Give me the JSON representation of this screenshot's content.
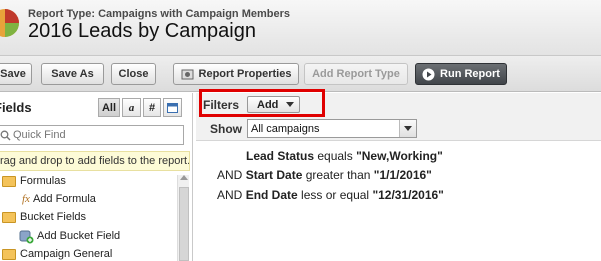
{
  "header": {
    "report_type": "Report Type: Campaigns with Campaign Members",
    "title": "2016 Leads by Campaign"
  },
  "toolbar": {
    "save": "Save",
    "save_as": "Save As",
    "close": "Close",
    "report_properties": "Report Properties",
    "add_report_type": "Add Report Type",
    "run_report": "Run Report"
  },
  "fields_panel": {
    "title": "Fields",
    "segments": [
      "All",
      "a",
      "#",
      "cal"
    ],
    "quick_find_placeholder": "Quick Find",
    "hint": "Drag and drop to add fields to the report.",
    "tree": [
      {
        "label": "Formulas",
        "type": "folder"
      },
      {
        "label": "Add Formula",
        "type": "item"
      },
      {
        "label": "Bucket Fields",
        "type": "folder"
      },
      {
        "label": "Add Bucket Field",
        "type": "item"
      },
      {
        "label": "Campaign General",
        "type": "folder"
      }
    ]
  },
  "filters": {
    "label": "Filters",
    "add_button": "Add",
    "show_label": "Show",
    "show_value": "All campaigns",
    "lines": [
      {
        "prefix": "",
        "field": "Lead Status",
        "operator": "equals",
        "value": "\"New,Working\""
      },
      {
        "prefix": "AND",
        "field": "Start Date",
        "operator": "greater than",
        "value": "\"1/1/2016\""
      },
      {
        "prefix": "AND",
        "field": "End Date",
        "operator": "less or equal",
        "value": "\"12/31/2016\""
      }
    ]
  },
  "colors": {
    "highlight": "#e00000",
    "hint_bg": "#fdfbd7",
    "folder": "#f4c35a"
  }
}
